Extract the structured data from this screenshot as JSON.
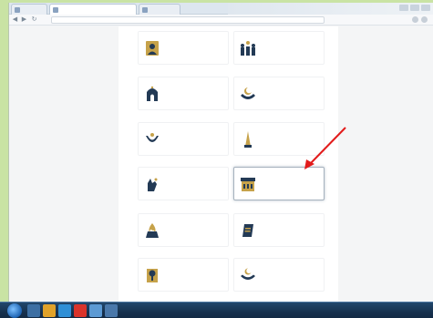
{
  "browser": {
    "tabs": [
      {
        "label": "",
        "active": false
      },
      {
        "label": "",
        "active": true
      },
      {
        "label": "",
        "active": false
      }
    ],
    "address": "",
    "nav": {
      "back": "◀",
      "forward": "▶",
      "reload": "↻"
    }
  },
  "page": {
    "cards": [
      {
        "icon": "person-portrait-icon",
        "text": "",
        "highlighted": false
      },
      {
        "icon": "group-people-icon",
        "text": "",
        "highlighted": false
      },
      {
        "icon": "mosque-icon",
        "text": "",
        "highlighted": false
      },
      {
        "icon": "hands-crescent-icon",
        "text": "",
        "highlighted": false
      },
      {
        "icon": "crescent-book-icon",
        "text": "",
        "highlighted": false
      },
      {
        "icon": "tower-icon",
        "text": "",
        "highlighted": false
      },
      {
        "icon": "hand-icon",
        "text": "",
        "highlighted": false
      },
      {
        "icon": "building-icon",
        "text": "",
        "highlighted": true
      },
      {
        "icon": "fire-hand-icon",
        "text": "",
        "highlighted": false
      },
      {
        "icon": "document-icon",
        "text": "",
        "highlighted": false
      },
      {
        "icon": "tree-icon",
        "text": "",
        "highlighted": false
      },
      {
        "icon": "crescent-hands-icon",
        "text": "",
        "highlighted": false
      }
    ]
  },
  "annotation": {
    "arrow_color": "#e21b1b"
  },
  "colors": {
    "icon_dark": "#233a55",
    "icon_gold": "#c6a24a",
    "desktop": "#c9e3a4",
    "taskbar": "#1b3a5c"
  },
  "taskbar": {
    "clock": ""
  }
}
